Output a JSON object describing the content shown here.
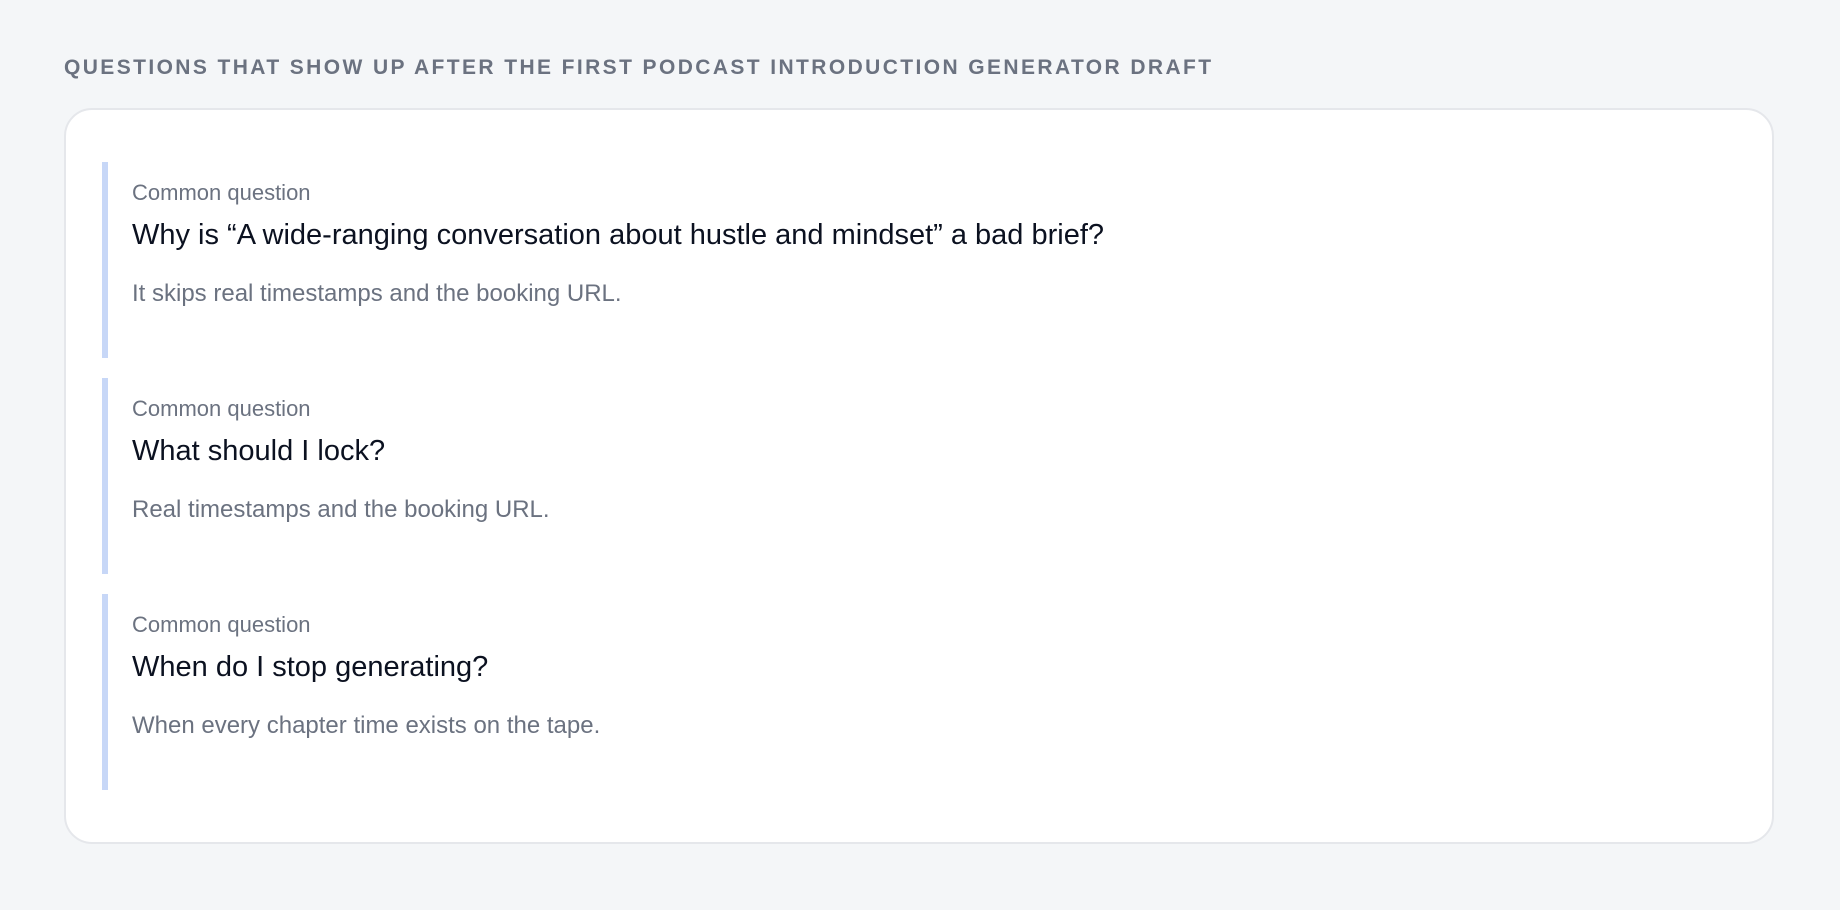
{
  "section": {
    "heading": "Questions that show up after the first podcast introduction generator draft"
  },
  "faq": {
    "items": [
      {
        "kicker": "Common question",
        "question": "Why is “A wide-ranging conversation about hustle and mindset” a bad brief?",
        "answer": "It skips real timestamps and the booking URL."
      },
      {
        "kicker": "Common question",
        "question": "What should I lock?",
        "answer": "Real timestamps and the booking URL."
      },
      {
        "kicker": "Common question",
        "question": "When do I stop generating?",
        "answer": "When every chapter time exists on the tape."
      }
    ]
  },
  "colors": {
    "page_background": "#f4f6f8",
    "card_background": "#ffffff",
    "accent_bar": "#c7d7f7",
    "heading_text": "#6b7280",
    "question_text": "#0b1120"
  }
}
